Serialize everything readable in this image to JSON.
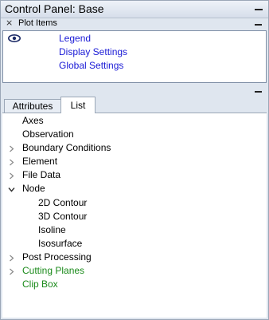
{
  "window": {
    "title": "Control Panel: Base"
  },
  "plot_items": {
    "header_label": "Plot Items",
    "items": [
      {
        "label": "Legend"
      },
      {
        "label": "Display Settings"
      },
      {
        "label": "Global Settings"
      }
    ]
  },
  "tabs": {
    "items": [
      {
        "label": "Attributes",
        "active": false
      },
      {
        "label": "List",
        "active": true
      }
    ]
  },
  "tree": {
    "items": [
      {
        "label": "Axes",
        "expander": "none",
        "color": "#000000"
      },
      {
        "label": "Observation",
        "expander": "none",
        "color": "#000000"
      },
      {
        "label": "Boundary Conditions",
        "expander": "collapsed",
        "color": "#000000"
      },
      {
        "label": "Element",
        "expander": "collapsed",
        "color": "#000000"
      },
      {
        "label": "File Data",
        "expander": "collapsed",
        "color": "#000000"
      },
      {
        "label": "Node",
        "expander": "expanded",
        "color": "#000000"
      },
      {
        "label": "2D Contour",
        "expander": "none",
        "color": "#000000"
      },
      {
        "label": "3D Contour",
        "expander": "none",
        "color": "#000000"
      },
      {
        "label": "Isoline",
        "expander": "none",
        "color": "#000000"
      },
      {
        "label": "Isosurface",
        "expander": "none",
        "color": "#000000"
      },
      {
        "label": "Post Processing",
        "expander": "collapsed",
        "color": "#000000"
      },
      {
        "label": "Cutting Planes",
        "expander": "collapsed",
        "color": "#1a8a1a"
      },
      {
        "label": "Clip Box",
        "expander": "none",
        "color": "#1a8a1a"
      }
    ]
  },
  "colors": {
    "link_blue": "#1a1ad6",
    "green_item": "#1a8a1a",
    "panel_bg": "#dfe6ef"
  }
}
